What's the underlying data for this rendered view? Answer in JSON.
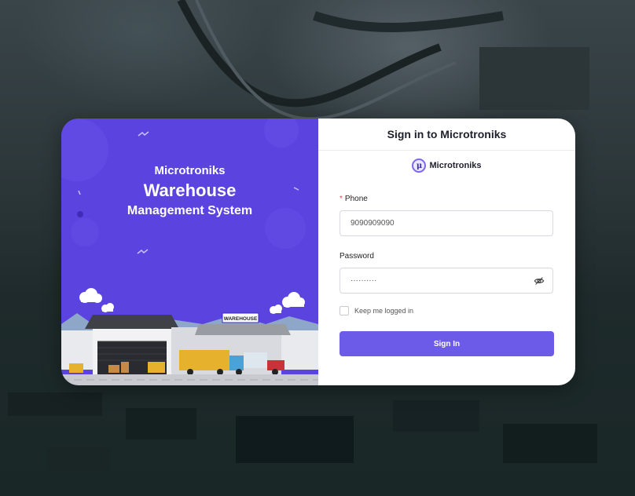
{
  "hero": {
    "line1": "Microtroniks",
    "line2": "Warehouse",
    "line3": "Management System",
    "sign_text": "WAREHOUSE"
  },
  "form": {
    "header_title": "Sign in to Microtroniks",
    "brand_name": "Microtroniks",
    "brand_symbol": "μ",
    "required_mark": "*",
    "phone_label": "Phone",
    "phone_value": "9090909090",
    "password_label": "Password",
    "password_value": "··········",
    "remember_label": "Keep me logged in",
    "submit_label": "Sign In"
  },
  "colors": {
    "accent": "#6c5ae8",
    "hero_bg": "#5b43e0",
    "required": "#e5484d"
  },
  "icons": {
    "password_toggle": "eye-off-icon"
  }
}
